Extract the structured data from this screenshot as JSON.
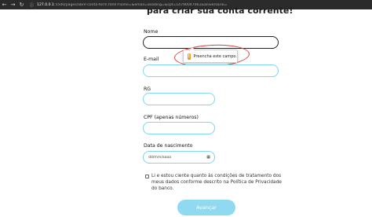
{
  "browser": {
    "url_host": "127.0.0.1",
    "url_rest": ":5500/pages/abrir-conta-form.html?nome=&email=asading=&cpf=14790047061&aniversario="
  },
  "form": {
    "heading": "para criar sua conta corrente!",
    "fields": [
      {
        "label": "Nome",
        "value": ""
      },
      {
        "label": "E-mail",
        "value": ""
      },
      {
        "label": "RG",
        "value": ""
      },
      {
        "label": "CPF (apenas números)",
        "value": ""
      },
      {
        "label": "Data de nascimento",
        "placeholder": "dd/mm/aaaa"
      }
    ],
    "validation_tooltip": "Preencha este campo.",
    "consent_text": "Li e estou ciente quanto às condições de tratamento dos meus dados conforme descrito na Política de Privacidade do banco.",
    "consent_checked": false,
    "submit_label": "Avançar"
  },
  "colors": {
    "field_border": "#7fd6ee",
    "button_bg": "#8fd9f1",
    "annotation_red": "#e23a3a",
    "warning": "#f39c12"
  }
}
